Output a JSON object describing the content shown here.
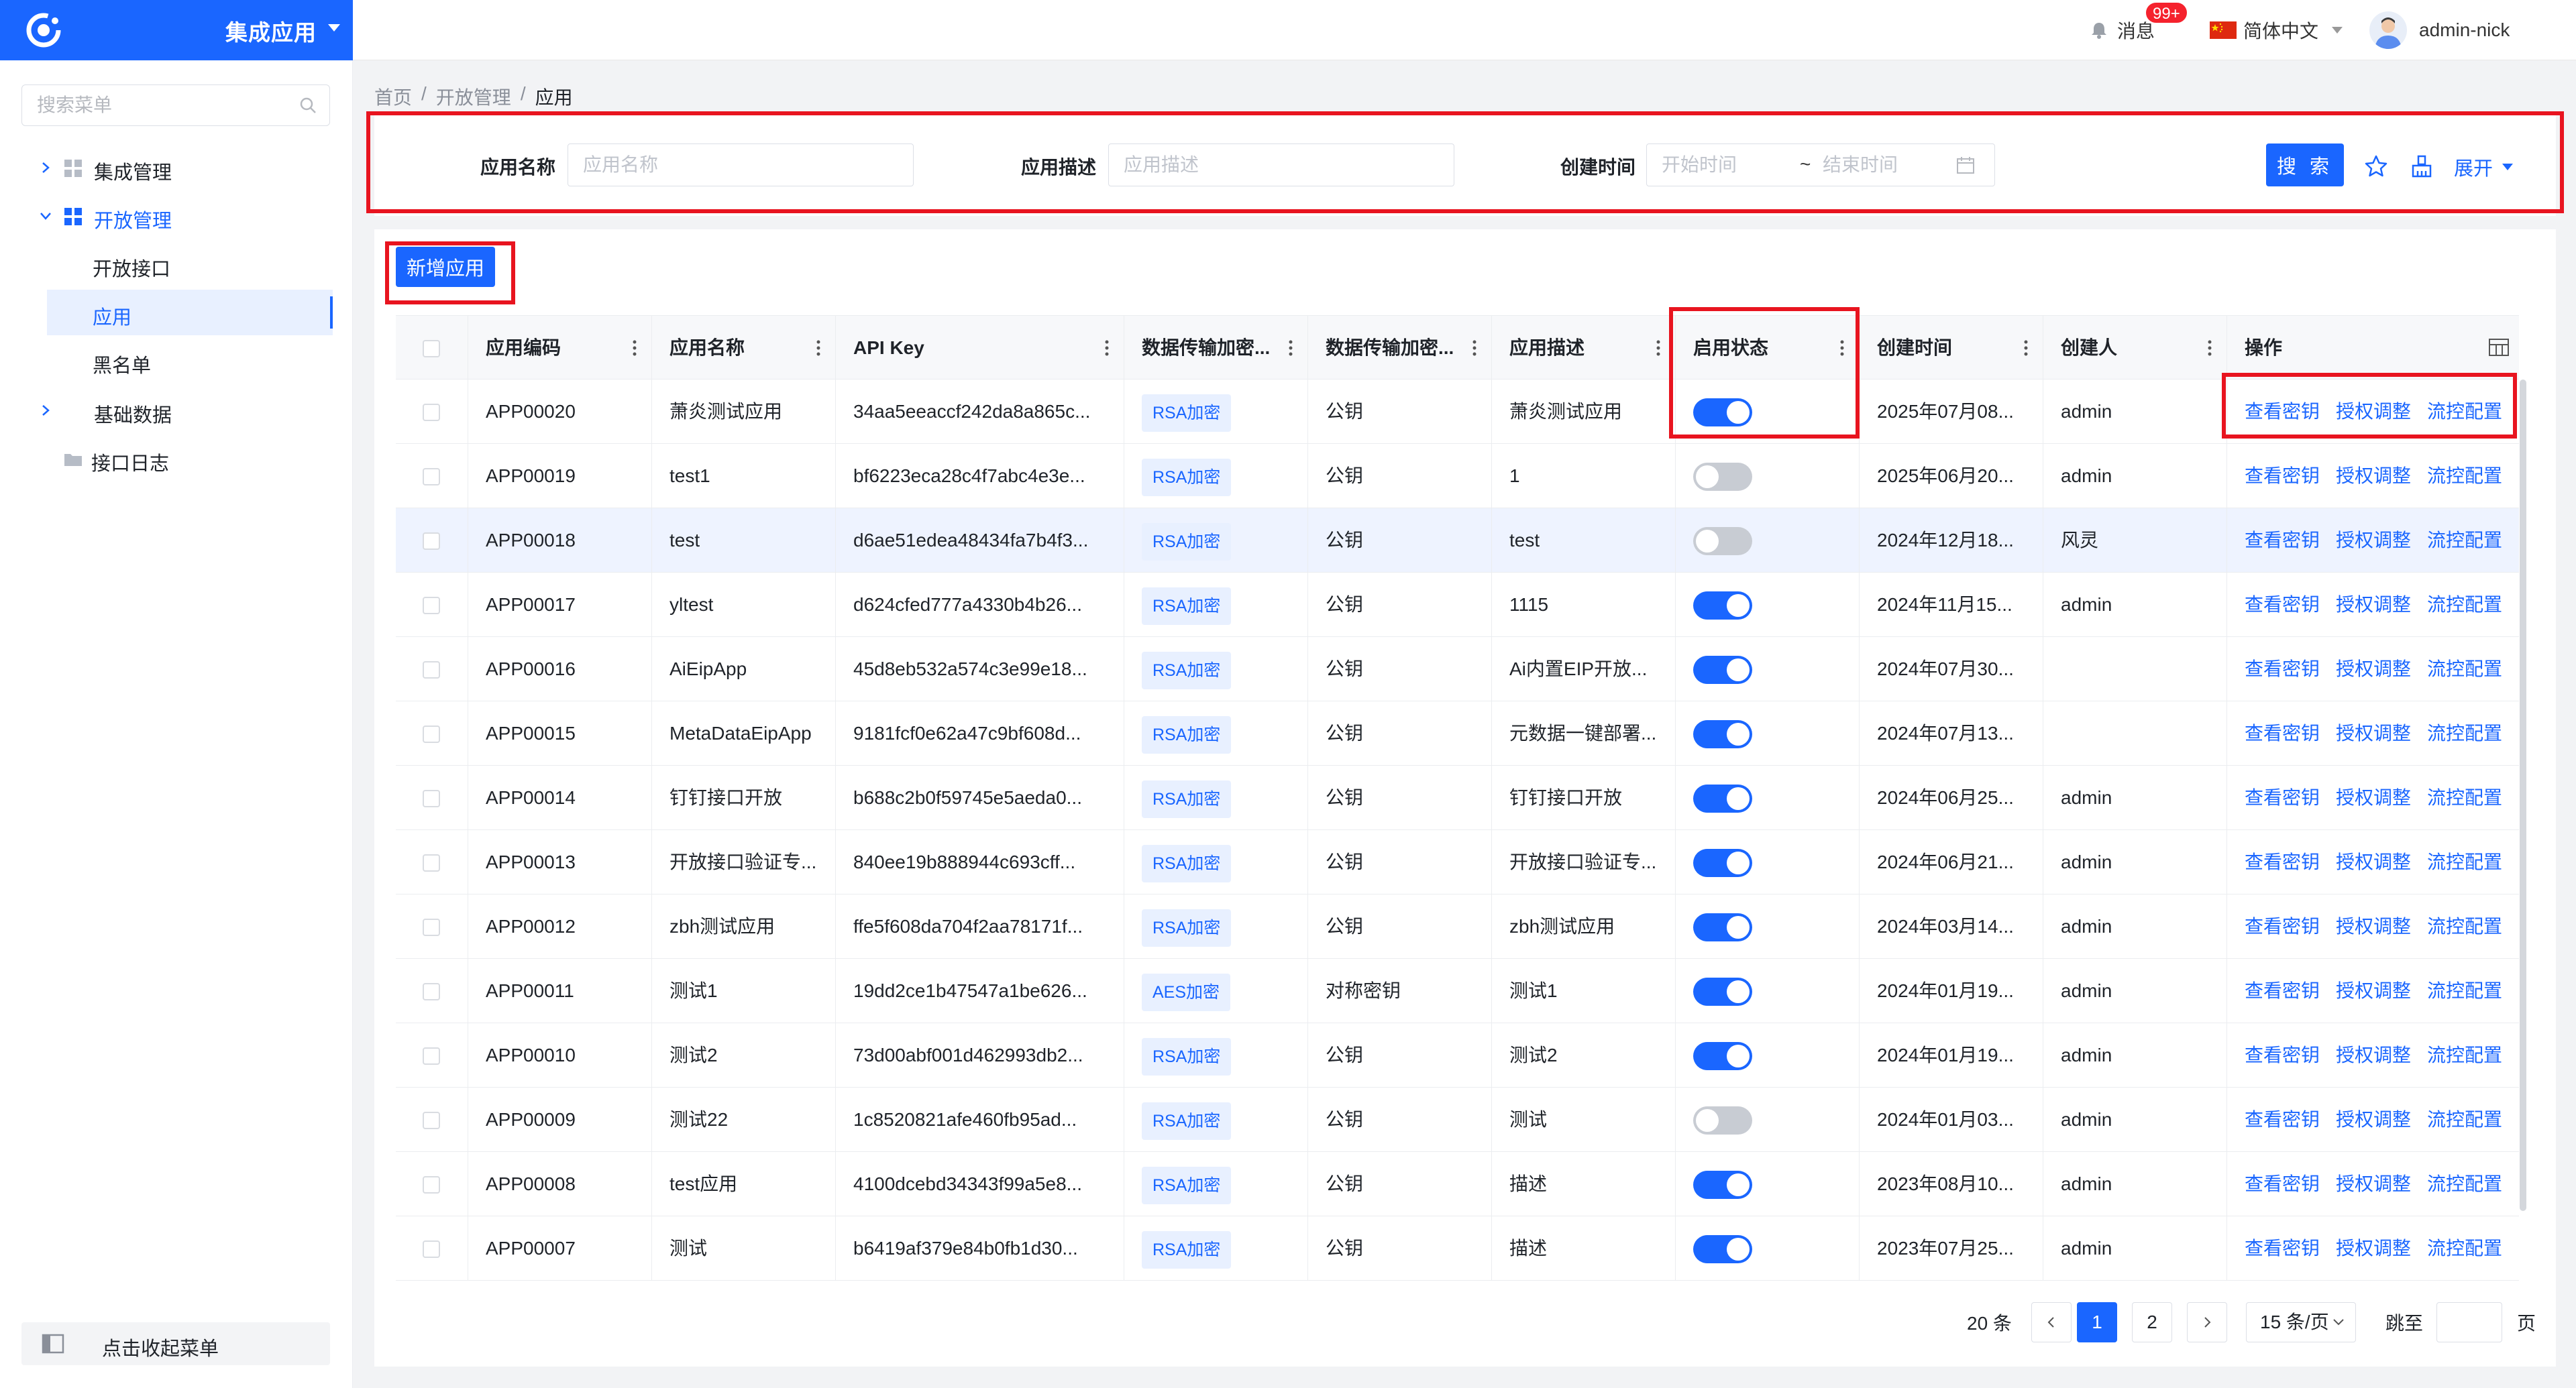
{
  "topbar": {
    "app_title": "集成应用",
    "messages_label": "消息",
    "messages_badge": "99+",
    "language": "简体中文",
    "username": "admin-nick"
  },
  "sidebar": {
    "search_placeholder": "搜索菜单",
    "items": [
      {
        "label": "集成管理"
      },
      {
        "label": "开放管理"
      },
      {
        "label": "开放接口"
      },
      {
        "label": "应用"
      },
      {
        "label": "黑名单"
      },
      {
        "label": "基础数据"
      },
      {
        "label": "接口日志"
      }
    ],
    "collapse_label": "点击收起菜单"
  },
  "breadcrumb": [
    "首页",
    "开放管理",
    "应用"
  ],
  "search": {
    "app_name_label": "应用名称",
    "app_name_placeholder": "应用名称",
    "app_desc_label": "应用描述",
    "app_desc_placeholder": "应用描述",
    "created_label": "创建时间",
    "start_placeholder": "开始时间",
    "end_placeholder": "结束时间",
    "range_sep": "~",
    "search_button": "搜 索",
    "expand_label": "展开"
  },
  "toolbar": {
    "add_button": "新增应用"
  },
  "table": {
    "columns": [
      "应用编码",
      "应用名称",
      "API Key",
      "数据传输加密...",
      "数据传输加密...",
      "应用描述",
      "启用状态",
      "创建时间",
      "创建人",
      "操作"
    ],
    "actions": [
      "查看密钥",
      "授权调整",
      "流控配置"
    ],
    "rows": [
      {
        "code": "APP00020",
        "name": "萧炎测试应用",
        "api_key": "34aa5eeaccf242da8a865c...",
        "enc": "RSA加密",
        "key_type": "公钥",
        "desc": "萧炎测试应用",
        "enabled": true,
        "created": "2025年07月08...",
        "creator": "admin"
      },
      {
        "code": "APP00019",
        "name": "test1",
        "api_key": "bf6223eca28c4f7abc4e3e...",
        "enc": "RSA加密",
        "key_type": "公钥",
        "desc": "1",
        "enabled": false,
        "created": "2025年06月20...",
        "creator": "admin"
      },
      {
        "code": "APP00018",
        "name": "test",
        "api_key": "d6ae51edea48434fa7b4f3...",
        "enc": "RSA加密",
        "key_type": "公钥",
        "desc": "test",
        "enabled": false,
        "created": "2024年12月18...",
        "creator": "风灵"
      },
      {
        "code": "APP00017",
        "name": "yltest",
        "api_key": "d624cfed777a4330b4b26...",
        "enc": "RSA加密",
        "key_type": "公钥",
        "desc": "1115",
        "enabled": true,
        "created": "2024年11月15...",
        "creator": "admin"
      },
      {
        "code": "APP00016",
        "name": "AiEipApp",
        "api_key": "45d8eb532a574c3e99e18...",
        "enc": "RSA加密",
        "key_type": "公钥",
        "desc": "Ai内置EIP开放...",
        "enabled": true,
        "created": "2024年07月30...",
        "creator": ""
      },
      {
        "code": "APP00015",
        "name": "MetaDataEipApp",
        "api_key": "9181fcf0e62a47c9bf608d...",
        "enc": "RSA加密",
        "key_type": "公钥",
        "desc": "元数据一键部署...",
        "enabled": true,
        "created": "2024年07月13...",
        "creator": ""
      },
      {
        "code": "APP00014",
        "name": "钉钉接口开放",
        "api_key": "b688c2b0f59745e5aeda0...",
        "enc": "RSA加密",
        "key_type": "公钥",
        "desc": "钉钉接口开放",
        "enabled": true,
        "created": "2024年06月25...",
        "creator": "admin"
      },
      {
        "code": "APP00013",
        "name": "开放接口验证专...",
        "api_key": "840ee19b888944c693cff...",
        "enc": "RSA加密",
        "key_type": "公钥",
        "desc": "开放接口验证专...",
        "enabled": true,
        "created": "2024年06月21...",
        "creator": "admin"
      },
      {
        "code": "APP00012",
        "name": "zbh测试应用",
        "api_key": "ffe5f608da704f2aa78171f...",
        "enc": "RSA加密",
        "key_type": "公钥",
        "desc": "zbh测试应用",
        "enabled": true,
        "created": "2024年03月14...",
        "creator": "admin"
      },
      {
        "code": "APP00011",
        "name": "测试1",
        "api_key": "19dd2ce1b47547a1be626...",
        "enc": "AES加密",
        "key_type": "对称密钥",
        "desc": "测试1",
        "enabled": true,
        "created": "2024年01月19...",
        "creator": "admin"
      },
      {
        "code": "APP00010",
        "name": "测试2",
        "api_key": "73d00abf001d462993db2...",
        "enc": "RSA加密",
        "key_type": "公钥",
        "desc": "测试2",
        "enabled": true,
        "created": "2024年01月19...",
        "creator": "admin"
      },
      {
        "code": "APP00009",
        "name": "测试22",
        "api_key": "1c8520821afe460fb95ad...",
        "enc": "RSA加密",
        "key_type": "公钥",
        "desc": "测试",
        "enabled": false,
        "created": "2024年01月03...",
        "creator": "admin"
      },
      {
        "code": "APP00008",
        "name": "test应用",
        "api_key": "4100dcebd34343f99a5e8...",
        "enc": "RSA加密",
        "key_type": "公钥",
        "desc": "描述",
        "enabled": true,
        "created": "2023年08月10...",
        "creator": "admin"
      },
      {
        "code": "APP00007",
        "name": "测试",
        "api_key": "b6419af379e84b0fb1d30...",
        "enc": "RSA加密",
        "key_type": "公钥",
        "desc": "描述",
        "enabled": true,
        "created": "2023年07月25...",
        "creator": "admin"
      }
    ]
  },
  "pagination": {
    "total": "20 条",
    "pages": [
      "1",
      "2"
    ],
    "current": "1",
    "page_size": "15 条/页",
    "jump_label": "跳至",
    "page_suffix": "页"
  },
  "colors": {
    "primary": "#1a66ff",
    "highlight_border": "#e8141f",
    "badge": "#f5222d"
  }
}
